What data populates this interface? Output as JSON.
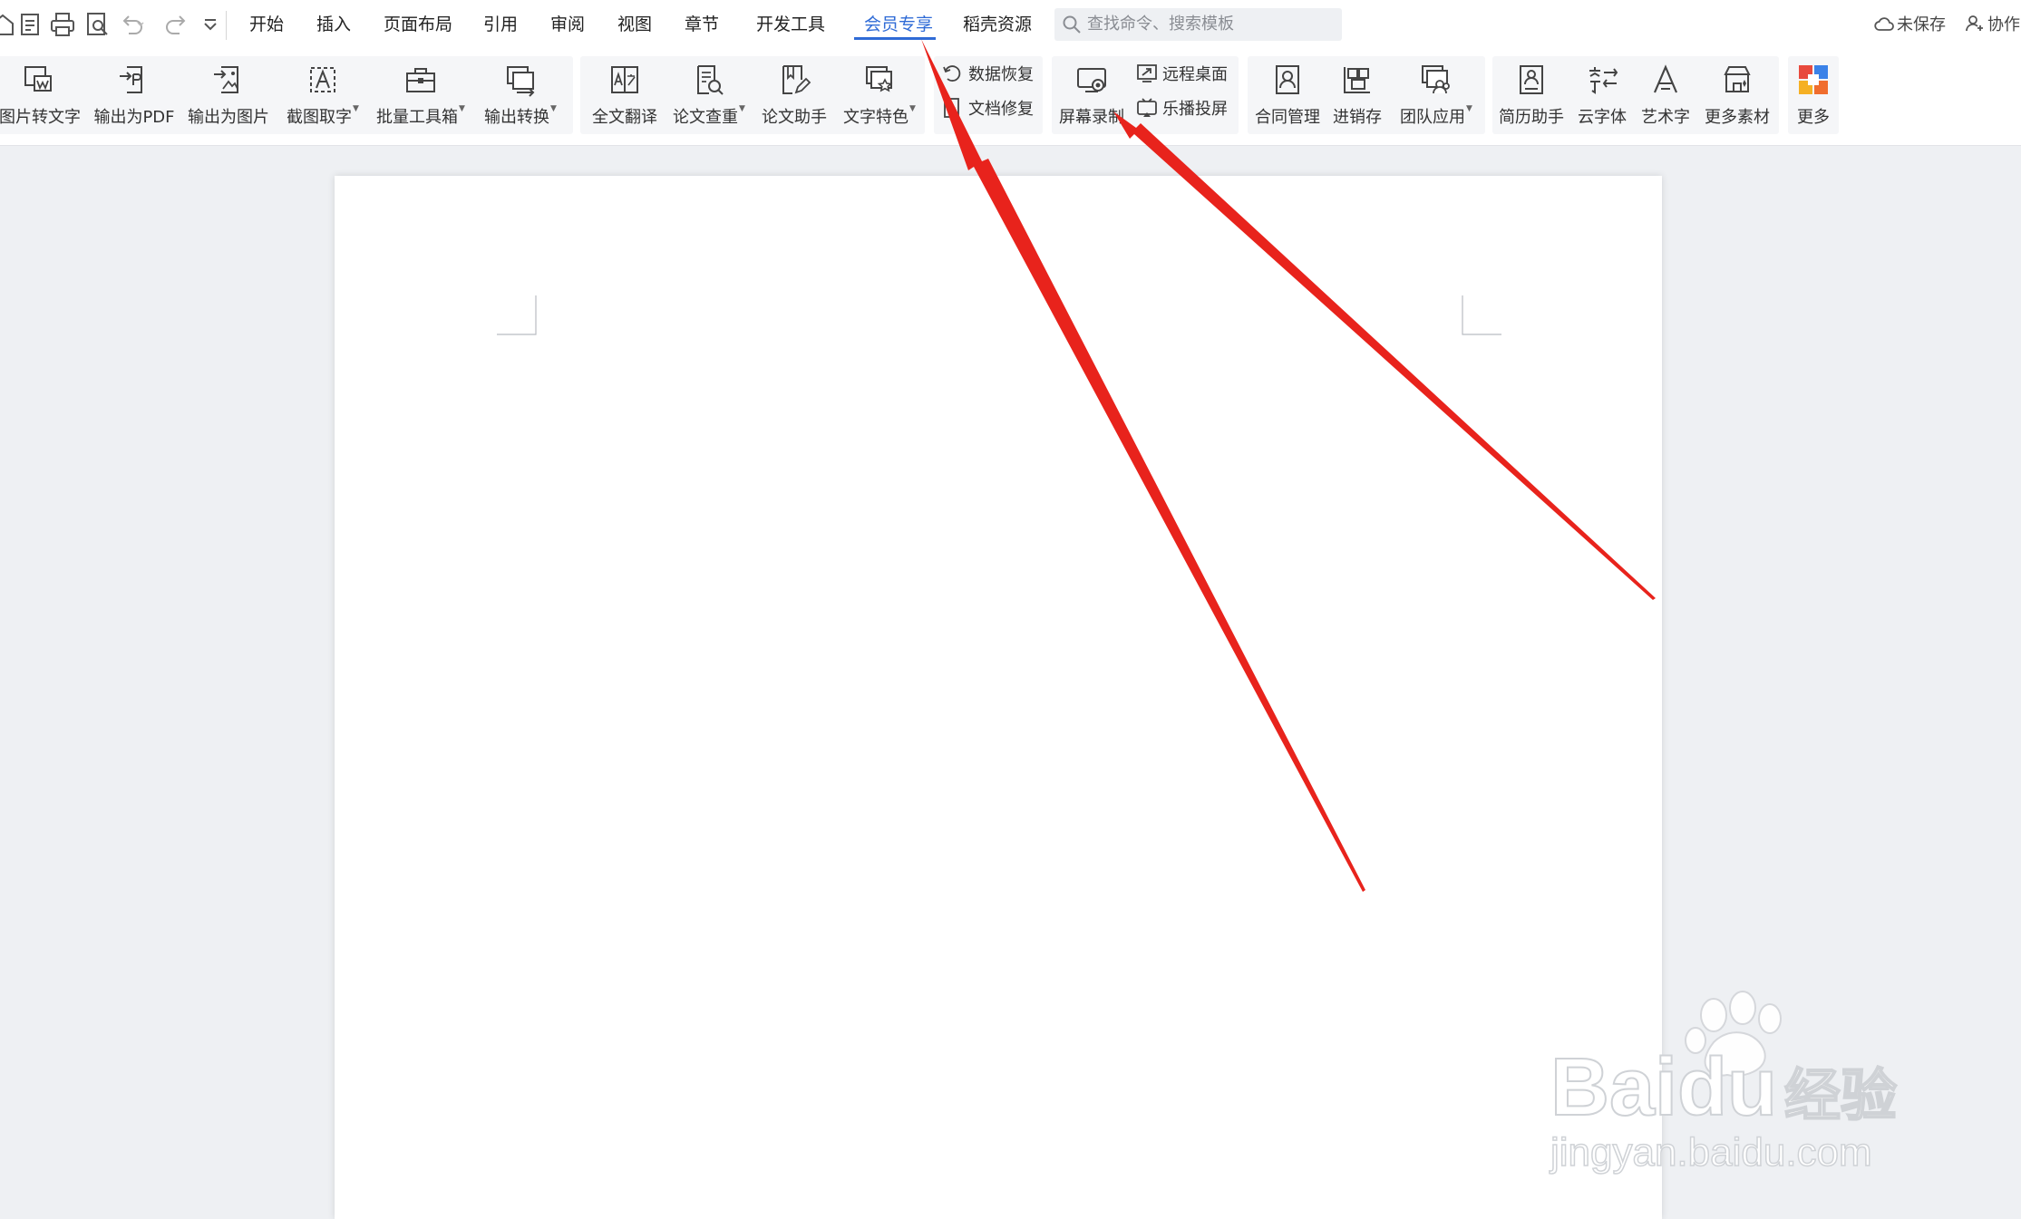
{
  "quick_access": {
    "icons": [
      "home-icon",
      "new-doc-icon",
      "print-icon",
      "print-preview-icon",
      "undo-icon",
      "redo-icon",
      "customize-icon"
    ]
  },
  "tabs": [
    {
      "label": "开始"
    },
    {
      "label": "插入"
    },
    {
      "label": "页面布局"
    },
    {
      "label": "引用"
    },
    {
      "label": "审阅"
    },
    {
      "label": "视图"
    },
    {
      "label": "章节"
    },
    {
      "label": "开发工具"
    },
    {
      "label": "会员专享"
    },
    {
      "label": "稻壳资源"
    }
  ],
  "active_tab": "会员专享",
  "search": {
    "placeholder": "查找命令、搜索模板"
  },
  "status": {
    "save_state": "未保存",
    "collab": "协作"
  },
  "ribbon": {
    "group1": [
      {
        "label": "图片转文字",
        "dropdown": false
      },
      {
        "label": "输出为PDF",
        "dropdown": false
      },
      {
        "label": "输出为图片",
        "dropdown": false
      },
      {
        "label": "截图取字",
        "dropdown": true
      },
      {
        "label": "批量工具箱",
        "dropdown": true
      },
      {
        "label": "输出转换",
        "dropdown": true
      }
    ],
    "group2": [
      {
        "label": "全文翻译",
        "dropdown": false
      },
      {
        "label": "论文查重",
        "dropdown": true
      },
      {
        "label": "论文助手",
        "dropdown": false
      },
      {
        "label": "文字特色",
        "dropdown": true
      }
    ],
    "group3": [
      {
        "label": "数据恢复"
      },
      {
        "label": "文档修复"
      }
    ],
    "group4": {
      "big": {
        "label": "屏幕录制"
      },
      "small": [
        {
          "label": "远程桌面"
        },
        {
          "label": "乐播投屏"
        }
      ]
    },
    "group5": [
      {
        "label": "合同管理",
        "dropdown": false
      },
      {
        "label": "进销存",
        "dropdown": false
      },
      {
        "label": "团队应用",
        "dropdown": true
      }
    ],
    "group6": [
      {
        "label": "简历助手"
      },
      {
        "label": "云字体"
      },
      {
        "label": "艺术字"
      },
      {
        "label": "更多素材"
      }
    ],
    "group7": [
      {
        "label": "更多"
      }
    ]
  },
  "watermark": {
    "brand": "Baidu",
    "cn": "经验",
    "url": "jingyan.baidu.com"
  },
  "colors": {
    "accent": "#2f6bd6",
    "arrow": "#e8231c",
    "canvas": "#eef0f3"
  }
}
